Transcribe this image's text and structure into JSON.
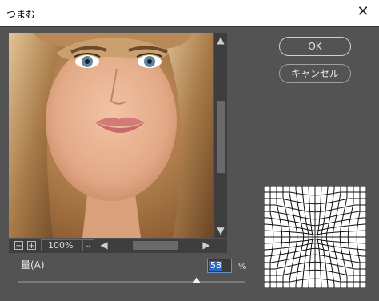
{
  "window": {
    "title": "つまむ"
  },
  "preview": {
    "image": "face-portrait-photo",
    "zoom_level": "100%",
    "zoom_out_label": "−",
    "zoom_in_label": "+",
    "zoom_dropdown_glyph": "⌄",
    "vscroll_up": "▲",
    "vscroll_down": "▼",
    "hscroll_left": "◀",
    "hscroll_right": "▶"
  },
  "buttons": {
    "ok": "OK",
    "cancel": "キャンセル"
  },
  "amount": {
    "label": "量(A)",
    "value": "58",
    "unit": "%",
    "min": -100,
    "max": 100
  },
  "icons": {
    "close": "✕",
    "mesh_preview": "pinch-distortion-grid-icon"
  },
  "colors": {
    "dialog_bg": "#535353",
    "selection": "#2b67c4",
    "title_bg": "#ffffff"
  }
}
